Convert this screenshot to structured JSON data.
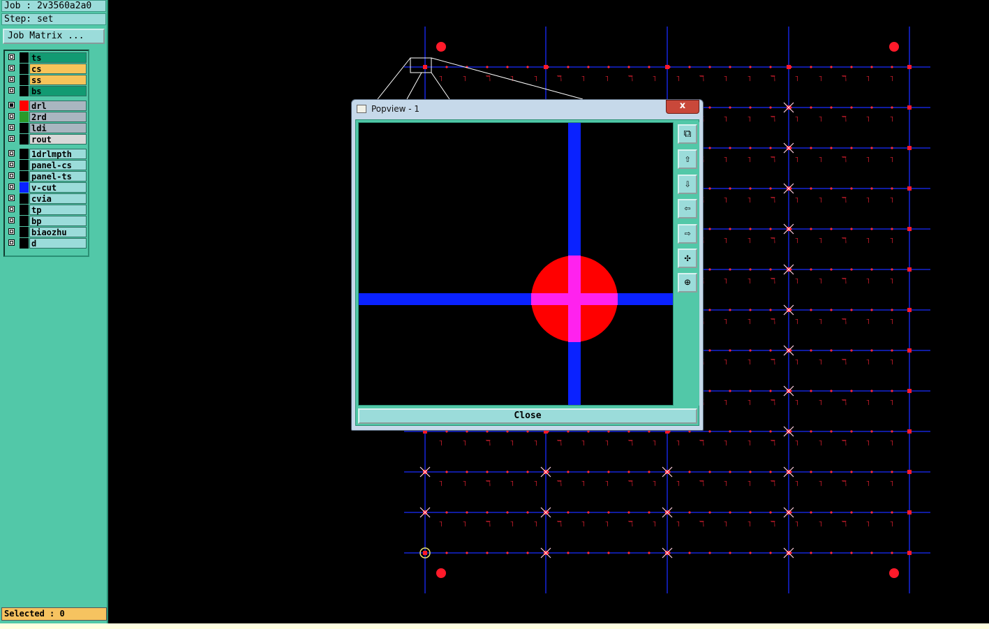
{
  "job": {
    "label": "Job : 2v3560a2a0",
    "step": "Step: set"
  },
  "job_matrix_button": "Job Matrix ...",
  "layers": [
    {
      "name": "ts",
      "color": "#129a72",
      "swatch": "",
      "checked": false
    },
    {
      "name": "cs",
      "color": "#f7c45a",
      "swatch": "",
      "checked": false
    },
    {
      "name": "ss",
      "color": "#f7c45a",
      "swatch": "",
      "checked": false
    },
    {
      "name": "bs",
      "color": "#129a72",
      "swatch": "",
      "checked": false
    },
    {
      "name": "drl",
      "color": "#a9b6c0",
      "swatch": "#ff0000",
      "checked": true
    },
    {
      "name": "2rd",
      "color": "#a9b6c0",
      "swatch": "#2a9a2a",
      "checked": false
    },
    {
      "name": "ldi",
      "color": "#a9b6c0",
      "swatch": "",
      "checked": false
    },
    {
      "name": "rout",
      "color": "#d8d8d8",
      "swatch": "",
      "checked": false
    },
    {
      "name": "1drlmpth",
      "color": "#9bdcda",
      "swatch": "",
      "checked": false
    },
    {
      "name": "panel-cs",
      "color": "#9bdcda",
      "swatch": "",
      "checked": false
    },
    {
      "name": "panel-ts",
      "color": "#9bdcda",
      "swatch": "",
      "checked": false
    },
    {
      "name": "v-cut",
      "color": "#9bdcda",
      "swatch": "#0a22ff",
      "checked": false
    },
    {
      "name": "cvia",
      "color": "#9bdcda",
      "swatch": "",
      "checked": false
    },
    {
      "name": "tp",
      "color": "#9bdcda",
      "swatch": "",
      "checked": false
    },
    {
      "name": "bp",
      "color": "#9bdcda",
      "swatch": "",
      "checked": false
    },
    {
      "name": "biaozhu",
      "color": "#9bdcda",
      "swatch": "",
      "checked": false
    },
    {
      "name": "d",
      "color": "#9bdcda",
      "swatch": "",
      "checked": false
    }
  ],
  "selected_label": "Selected : 0",
  "popup": {
    "title": "Popview - 1",
    "close_x": "x",
    "close_label": "Close",
    "tools": [
      "zoom-window-icon",
      "pan-up-icon",
      "pan-down-icon",
      "pan-left-icon",
      "pan-right-icon",
      "zoom-fit-icon",
      "zoom-home-icon"
    ]
  },
  "colors": {
    "panel": "#52c8a8",
    "vcut": "#0a22ff",
    "drill": "#ff1a2a",
    "overlap": "#ff22ee"
  }
}
